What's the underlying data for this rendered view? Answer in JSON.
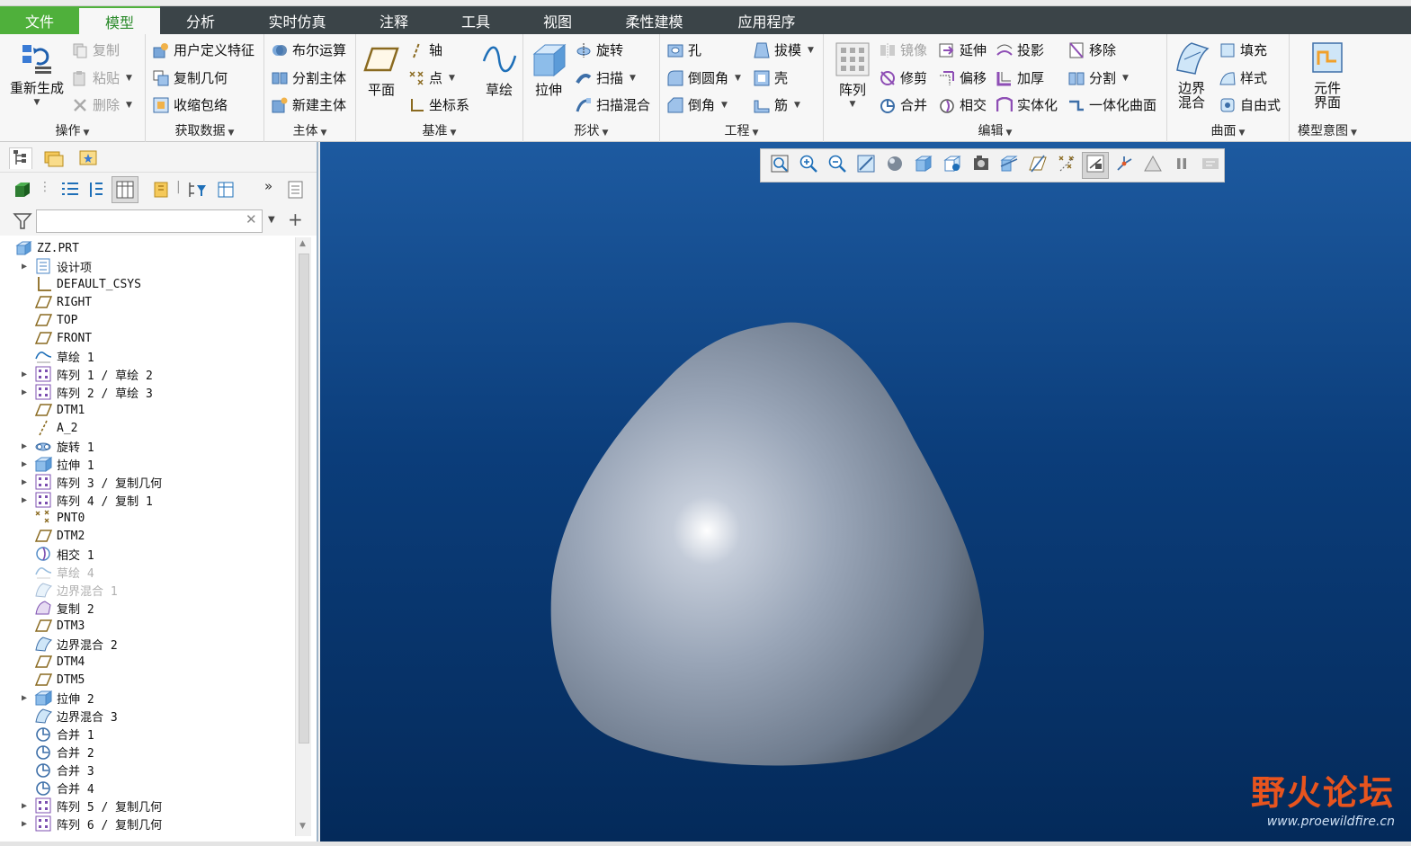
{
  "menu": {
    "tabs": [
      "文件",
      "模型",
      "分析",
      "实时仿真",
      "注释",
      "工具",
      "视图",
      "柔性建模",
      "应用程序"
    ],
    "active": "模型"
  },
  "ribbon": {
    "groups": {
      "operations": {
        "label": "操作",
        "regenerate": "重新生成",
        "copy": "复制",
        "paste": "粘贴",
        "delete": "删除"
      },
      "get_data": {
        "label": "获取数据",
        "udf": "用户定义特征",
        "copy_geom": "复制几何",
        "shrinkwrap": "收缩包络"
      },
      "body": {
        "label": "主体",
        "boolean": "布尔运算",
        "split_body": "分割主体",
        "new_body": "新建主体"
      },
      "datum": {
        "label": "基准",
        "plane": "平面",
        "axis": "轴",
        "point": "点",
        "csys": "坐标系",
        "sketch": "草绘"
      },
      "shapes": {
        "label": "形状",
        "extrude": "拉伸",
        "revolve": "旋转",
        "sweep": "扫描",
        "swept_blend": "扫描混合"
      },
      "engineering": {
        "label": "工程",
        "hole": "孔",
        "round": "倒圆角",
        "chamfer": "倒角",
        "draft": "拔模",
        "shell": "壳",
        "rib": "筋"
      },
      "editing": {
        "label": "编辑",
        "pattern": "阵列",
        "mirror": "镜像",
        "trim": "修剪",
        "merge": "合并",
        "extend": "延伸",
        "offset": "偏移",
        "intersect": "相交",
        "project": "投影",
        "thicken": "加厚",
        "solidify": "实体化",
        "remove": "移除",
        "split": "分割",
        "unify": "一体化曲面"
      },
      "surfaces": {
        "label": "曲面",
        "boundary_blend": [
          "边界",
          "混合"
        ],
        "fill": "填充",
        "style": "样式",
        "freestyle": "自由式"
      },
      "model_intent": {
        "label": "模型意图",
        "component_interface": [
          "元件",
          "界面"
        ]
      }
    }
  },
  "search": {
    "placeholder": ""
  },
  "tree": [
    {
      "label": "ZZ.PRT",
      "icon": "part-icon",
      "expandable": false,
      "root": true
    },
    {
      "label": "设计项",
      "icon": "design-items-icon",
      "expandable": true
    },
    {
      "label": "DEFAULT_CSYS",
      "icon": "csys-icon",
      "expandable": false
    },
    {
      "label": "RIGHT",
      "icon": "datum-plane-icon",
      "expandable": false
    },
    {
      "label": "TOP",
      "icon": "datum-plane-icon",
      "expandable": false
    },
    {
      "label": "FRONT",
      "icon": "datum-plane-icon",
      "expandable": false
    },
    {
      "label": "草绘 1",
      "icon": "sketch-icon",
      "expandable": false
    },
    {
      "label": "阵列 1 / 草绘 2",
      "icon": "pattern-icon",
      "expandable": true
    },
    {
      "label": "阵列 2 / 草绘 3",
      "icon": "pattern-icon",
      "expandable": true
    },
    {
      "label": "DTM1",
      "icon": "datum-plane-icon",
      "expandable": false
    },
    {
      "label": "A_2",
      "icon": "axis-icon",
      "expandable": false
    },
    {
      "label": "旋转 1",
      "icon": "revolve-icon",
      "expandable": true
    },
    {
      "label": "拉伸 1",
      "icon": "extrude-icon",
      "expandable": true
    },
    {
      "label": "阵列 3 / 复制几何",
      "icon": "pattern-icon",
      "expandable": true
    },
    {
      "label": "阵列 4 / 复制 1",
      "icon": "pattern-icon",
      "expandable": true
    },
    {
      "label": "PNT0",
      "icon": "datum-point-icon",
      "expandable": false
    },
    {
      "label": "DTM2",
      "icon": "datum-plane-icon",
      "expandable": false
    },
    {
      "label": "相交 1",
      "icon": "intersect-icon",
      "expandable": false
    },
    {
      "label": "草绘 4",
      "icon": "sketch-icon",
      "expandable": false,
      "faded": true
    },
    {
      "label": "边界混合 1",
      "icon": "boundary-blend-icon",
      "expandable": false,
      "faded": true
    },
    {
      "label": "复制 2",
      "icon": "copy-surface-icon",
      "expandable": false
    },
    {
      "label": "DTM3",
      "icon": "datum-plane-icon",
      "expandable": false
    },
    {
      "label": "边界混合 2",
      "icon": "boundary-blend-icon",
      "expandable": false
    },
    {
      "label": "DTM4",
      "icon": "datum-plane-icon",
      "expandable": false
    },
    {
      "label": "DTM5",
      "icon": "datum-plane-icon",
      "expandable": false
    },
    {
      "label": "拉伸 2",
      "icon": "extrude-icon",
      "expandable": true
    },
    {
      "label": "边界混合 3",
      "icon": "boundary-blend-icon",
      "expandable": false
    },
    {
      "label": "合并 1",
      "icon": "merge-icon",
      "expandable": false
    },
    {
      "label": "合并 2",
      "icon": "merge-icon",
      "expandable": false
    },
    {
      "label": "合并 3",
      "icon": "merge-icon",
      "expandable": false
    },
    {
      "label": "合并 4",
      "icon": "merge-icon",
      "expandable": false
    },
    {
      "label": "阵列 5 / 复制几何",
      "icon": "pattern-icon",
      "expandable": true
    },
    {
      "label": "阵列 6 / 复制几何",
      "icon": "pattern-icon",
      "expandable": true
    }
  ],
  "viewport": {
    "toolbar_icons": [
      "refit-icon",
      "zoom-in-icon",
      "zoom-out-icon",
      "repaint-icon",
      "perspective-icon",
      "display-style-icon",
      "saved-orientations-icon",
      "view-manager-icon",
      "section-icon",
      "datum-display-icon",
      "annotation-display-icon",
      "spin-center-icon",
      "axis-display-icon",
      "point-display-icon",
      "pause-icon",
      "annotation-filter-icon"
    ],
    "bg_top": "#1d5aa0",
    "bg_bottom": "#042a5a",
    "model_color": "#9aa6b8"
  },
  "watermark": {
    "title": "野火论坛",
    "url": "www.proewildfire.cn"
  },
  "colors": {
    "menubar": "#3b4448",
    "file_tab": "#4fb03b",
    "accent": "#2a8a2a"
  }
}
